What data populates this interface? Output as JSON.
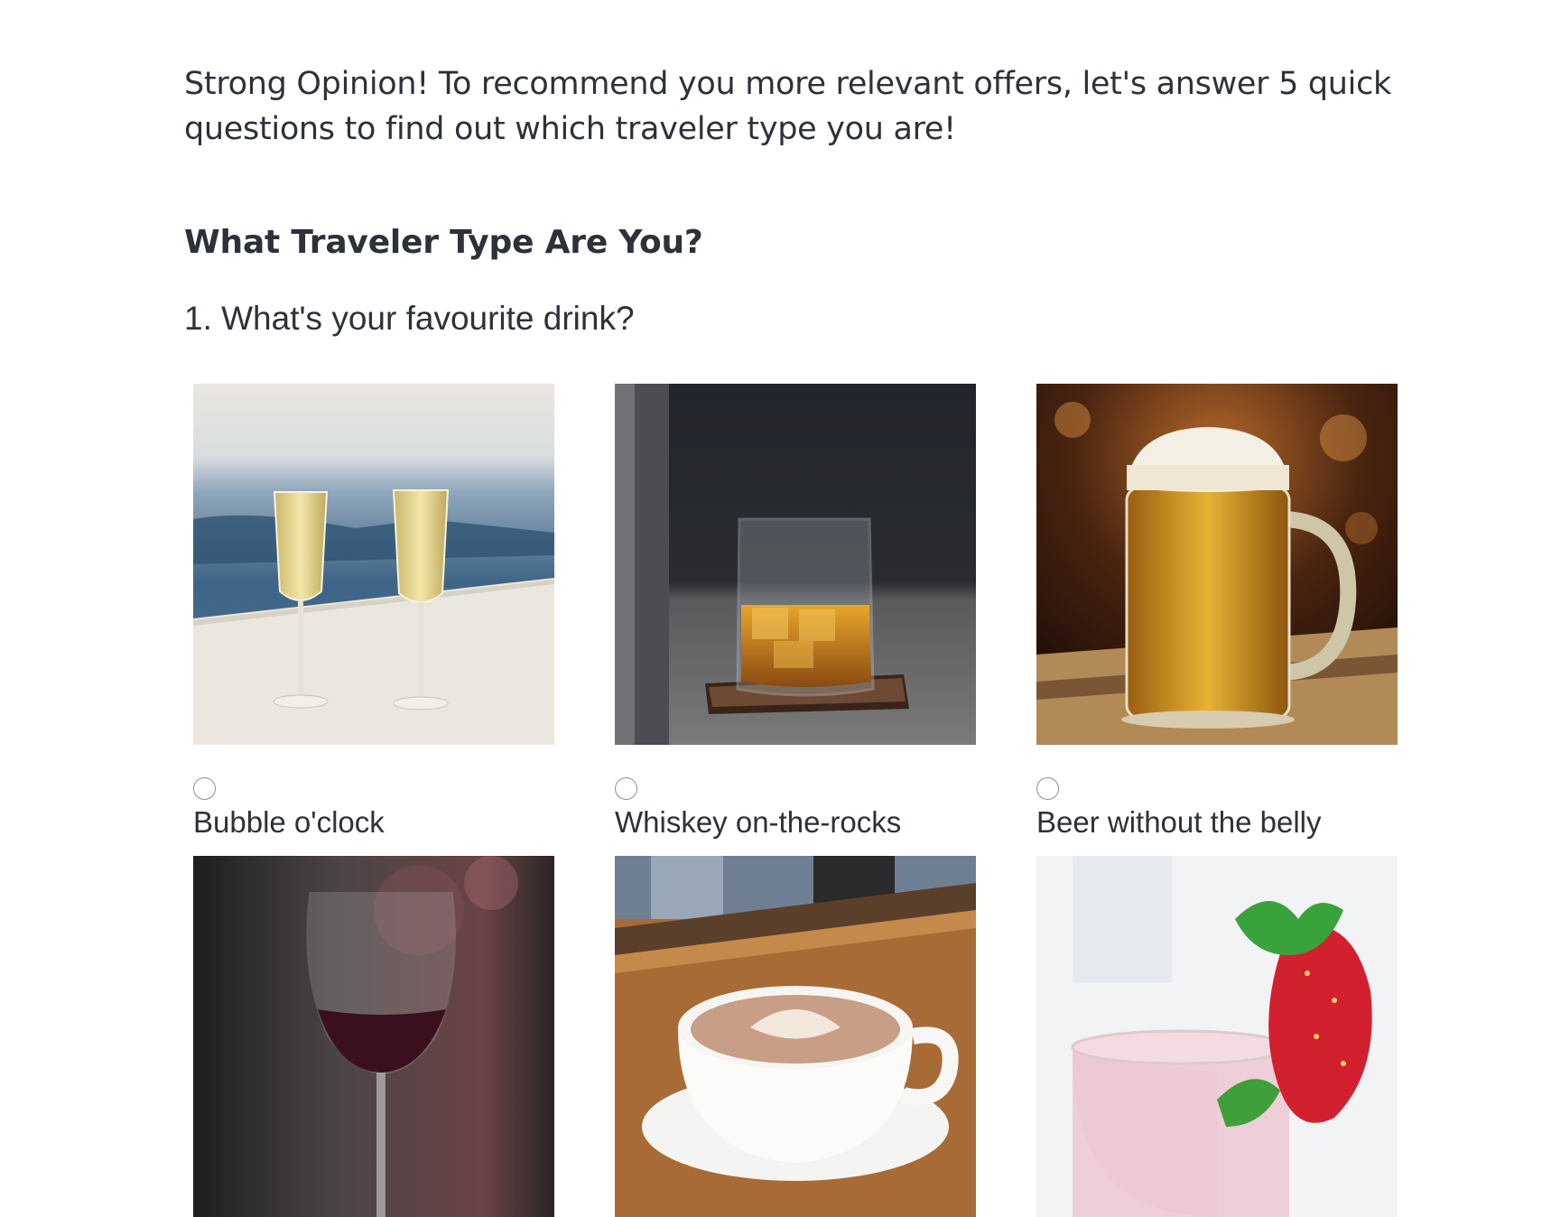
{
  "intro": {
    "text": "Strong Opinion! To recommend you more relevant offers, let's answer 5 quick questions to find out which traveler type you are!"
  },
  "quiz": {
    "title": "What Traveler Type Are You?",
    "question": "1. What's your favourite drink?",
    "options": [
      {
        "label": "Bubble o'clock",
        "image": "champagne-glasses"
      },
      {
        "label": "Whiskey on-the-rocks",
        "image": "whiskey-glass"
      },
      {
        "label": "Beer without the belly",
        "image": "beer-mug"
      },
      {
        "label": "",
        "image": "red-wine-glass"
      },
      {
        "label": "",
        "image": "cappuccino-cup"
      },
      {
        "label": "",
        "image": "strawberry-smoothie"
      }
    ]
  }
}
